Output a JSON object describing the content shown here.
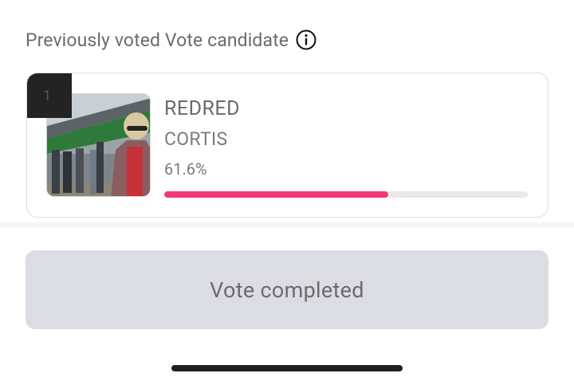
{
  "section": {
    "title": "Previously voted Vote candidate",
    "info_icon": "info-icon"
  },
  "candidate": {
    "rank": "1",
    "song": "REDRED",
    "artist": "CORTIS",
    "percent_label": "61.6%",
    "vote_share": 0.616,
    "bar_color": "#f2387a"
  },
  "action": {
    "vote_button_label": "Vote completed"
  }
}
